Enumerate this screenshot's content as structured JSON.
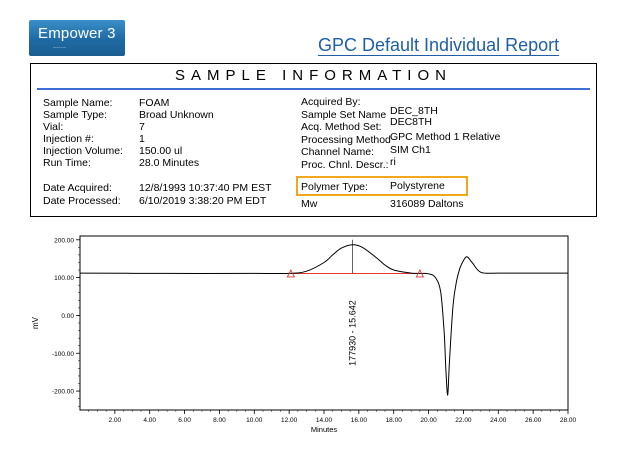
{
  "header": {
    "logo_text": "Empower 3",
    "title": "GPC Default Individual Report"
  },
  "sample_info": {
    "heading": "SAMPLE INFORMATION",
    "left_labels": [
      "Sample Name:",
      "Sample Type:",
      "Vial:",
      "Injection #:",
      "Injection Volume:",
      "Run Time:",
      "Date Acquired:",
      "Date Processed:"
    ],
    "left_values": [
      "FOAM",
      "Broad Unknown",
      "7",
      "1",
      "150.00 ul",
      "28.0 Minutes",
      "12/8/1993 10:37:40 PM EST",
      "6/10/2019 3:38:20 PM EDT"
    ],
    "right_labels": [
      "Acquired By:",
      "Sample Set Name",
      "Acq. Method Set:",
      "Processing Method",
      "Channel Name:",
      "Proc. Chnl. Descr.:",
      "Polymer Type:",
      "Mw"
    ],
    "right_values": [
      "DEC_8TH",
      "DEC8TH",
      "GPC Method 1 Relative",
      "SIM Ch1",
      "ri",
      "Polystyrene",
      "316089 Daltons"
    ]
  },
  "chart_data": {
    "type": "line",
    "xlabel": "Minutes",
    "ylabel": "mV",
    "xlim": [
      0,
      28.0
    ],
    "ylim": [
      -250,
      210
    ],
    "x_ticks": [
      "2.00",
      "4.00",
      "6.00",
      "8.00",
      "10.00",
      "12.00",
      "14.00",
      "16.00",
      "18.00",
      "20.00",
      "22.00",
      "24.00",
      "26.00",
      "28.00"
    ],
    "y_ticks": [
      "200.00",
      "100.00",
      "0.00",
      "-100.00",
      "-200.00"
    ],
    "x_tick_values": [
      2,
      4,
      6,
      8,
      10,
      12,
      14,
      16,
      18,
      20,
      22,
      24,
      26,
      28
    ],
    "y_tick_values": [
      200,
      100,
      0,
      -100,
      -200
    ],
    "series": [
      {
        "x": [
          0,
          5,
          10,
          12.0,
          13.0,
          14.0,
          14.5,
          15.0,
          15.64,
          16.2,
          17.0,
          17.5,
          18.0,
          19.0,
          19.5,
          20.0,
          20.4,
          20.7,
          20.9,
          21.0,
          21.1,
          21.2,
          21.4,
          21.6,
          21.8,
          22.0,
          22.2,
          22.5,
          23.0,
          24.0,
          25.0,
          28.0
        ],
        "y": [
          112,
          111,
          111,
          111,
          117,
          140,
          160,
          178,
          187,
          180,
          153,
          133,
          120,
          112,
          111,
          110,
          100,
          60,
          -50,
          -150,
          -210,
          -120,
          25,
          90,
          125,
          145,
          155,
          140,
          114,
          112,
          112,
          112
        ]
      }
    ],
    "baseline": {
      "x": [
        12.1,
        19.5
      ],
      "y": [
        111,
        111
      ]
    },
    "peak_label": "177930 - 15.642",
    "peak_x": 15.642
  }
}
